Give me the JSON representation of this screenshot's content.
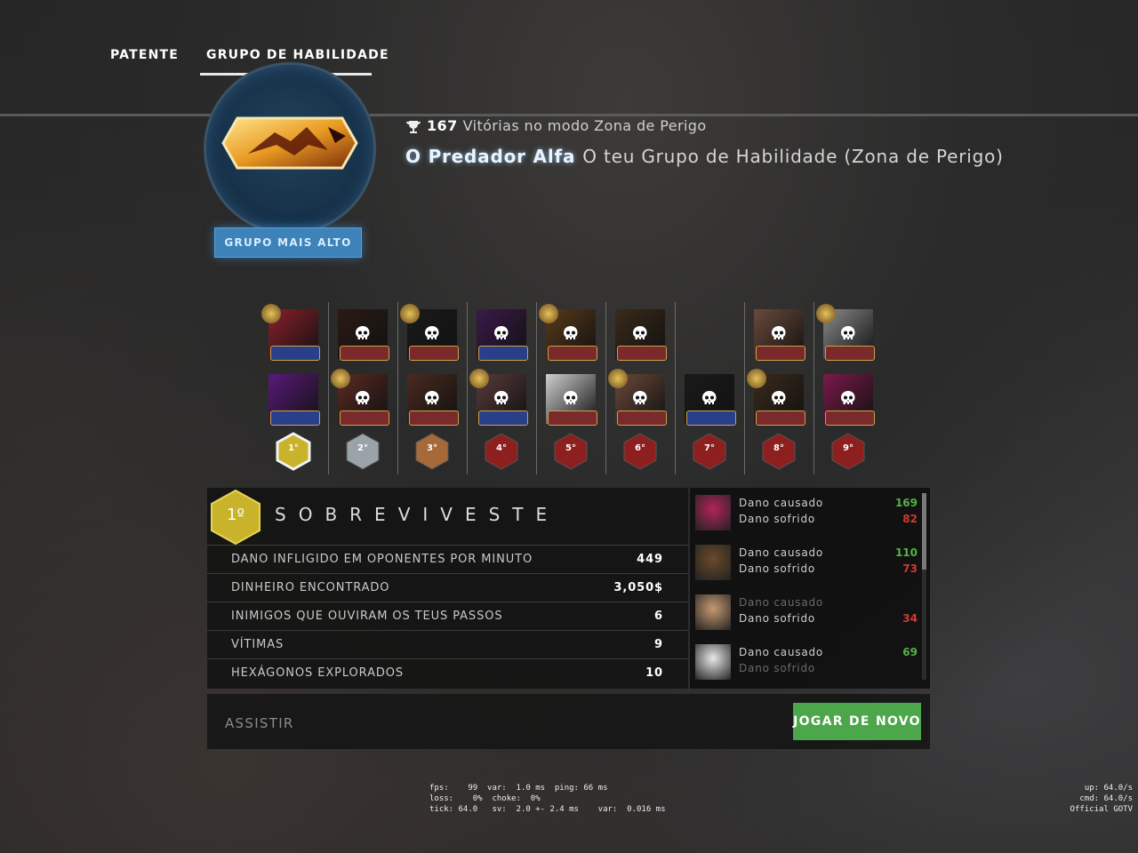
{
  "tabs": {
    "rank": "PATENTE",
    "skill_group": "GRUPO DE HABILIDADE",
    "active": "skill_group"
  },
  "rank_panel": {
    "button_label": "GRUPO MAIS ALTO"
  },
  "wins": {
    "count": "167",
    "label": "Vitórias no modo Zona de Perigo"
  },
  "skill": {
    "name": "O Predador Alfa",
    "description": "O teu Grupo de Habilidade (Zona de Perigo)"
  },
  "placements": [
    {
      "place": "1°",
      "color": "#c8b32a",
      "players": 2,
      "highlight": true
    },
    {
      "place": "2°",
      "color": "#9aa3a8",
      "players": 2
    },
    {
      "place": "3°",
      "color": "#a66a3a",
      "players": 2
    },
    {
      "place": "4°",
      "color": "#8e1f1f",
      "players": 2
    },
    {
      "place": "5°",
      "color": "#8e1f1f",
      "players": 2
    },
    {
      "place": "6°",
      "color": "#8e1f1f",
      "players": 2
    },
    {
      "place": "7°",
      "color": "#8e1f1f",
      "players": 1
    },
    {
      "place": "8°",
      "color": "#8e1f1f",
      "players": 2
    },
    {
      "place": "9°",
      "color": "#8e1f1f",
      "players": 2
    }
  ],
  "result": {
    "place": "1º",
    "title": "SOBREVIVESTE",
    "stats": [
      {
        "label": "DANO INFLIGIDO EM OPONENTES POR MINUTO",
        "value": "449"
      },
      {
        "label": "DINHEIRO ENCONTRADO",
        "value": "3,050$"
      },
      {
        "label": "INIMIGOS QUE OUVIRAM OS TEUS PASSOS",
        "value": "6"
      },
      {
        "label": "VÍTIMAS",
        "value": "9"
      },
      {
        "label": "HEXÁGONOS EXPLORADOS",
        "value": "10"
      }
    ]
  },
  "opponents": [
    {
      "dealt_label": "Dano causado",
      "taken_label": "Dano sofrido",
      "dealt": "169",
      "taken": "82",
      "color": "#b2245a"
    },
    {
      "dealt_label": "Dano causado",
      "taken_label": "Dano sofrido",
      "dealt": "110",
      "taken": "73",
      "color": "#6a4a2a"
    },
    {
      "dealt_label": "Dano causado",
      "taken_label": "Dano sofrido",
      "dealt": "",
      "taken": "34",
      "color": "#c69a72"
    },
    {
      "dealt_label": "Dano causado",
      "taken_label": "Dano sofrido",
      "dealt": "69",
      "taken": "",
      "color": "#e8e8e8"
    }
  ],
  "footer": {
    "watch": "ASSISTIR",
    "play_again": "JOGAR DE NOVO"
  },
  "netgraph": {
    "left": "fps:    99  var:  1.0 ms  ping: 66 ms\nloss:    0%  choke:  0%\ntick: 64.0   sv:  2.0 +- 2.4 ms    var:  0.016 ms",
    "right": "up: 64.0/s\ncmd: 64.0/s\nOfficial GOTV"
  }
}
